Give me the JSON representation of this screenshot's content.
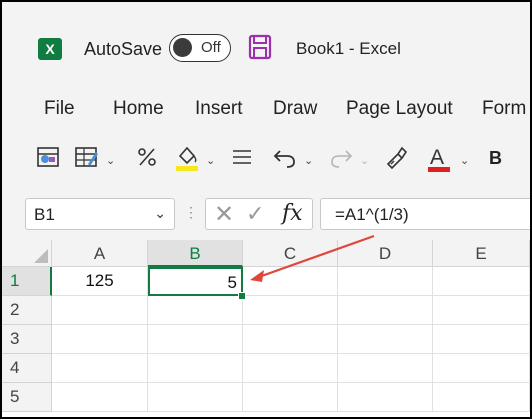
{
  "titlebar": {
    "app_icon": "X",
    "autosave_label": "AutoSave",
    "autosave_state": "Off",
    "save_icon": "floppy-disk-icon",
    "document_title": "Book1  -  Excel"
  },
  "ribbon_tabs": [
    "File",
    "Home",
    "Insert",
    "Draw",
    "Page Layout",
    "Form"
  ],
  "toolbar": {
    "bold_label": "B",
    "font_color_letter": "A",
    "fill_color": "#f8e71c",
    "font_color": "#e02020"
  },
  "formula_bar": {
    "name_box": "B1",
    "formula": "=A1^(1/3)",
    "fx_label": "fx"
  },
  "grid": {
    "columns": [
      "A",
      "B",
      "C",
      "D",
      "E"
    ],
    "rows": [
      "1",
      "2",
      "3",
      "4",
      "5"
    ],
    "cells": {
      "A1": "125",
      "B1": "5"
    },
    "selected_cell": "B1",
    "accent_color": "#107c41",
    "arrow_color": "#e0463a"
  }
}
